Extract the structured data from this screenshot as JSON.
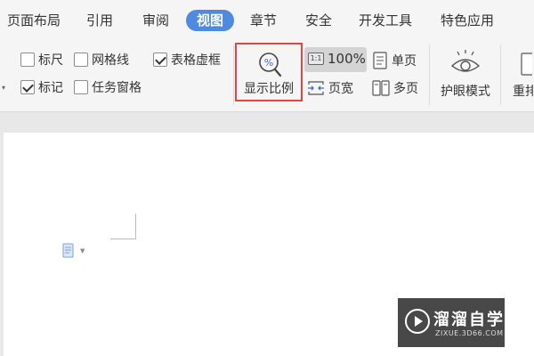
{
  "tabs": [
    {
      "label": "页面布局",
      "active": false
    },
    {
      "label": "引用",
      "active": false
    },
    {
      "label": "审阅",
      "active": false
    },
    {
      "label": "视图",
      "active": true
    },
    {
      "label": "章节",
      "active": false
    },
    {
      "label": "安全",
      "active": false
    },
    {
      "label": "开发工具",
      "active": false
    },
    {
      "label": "特色应用",
      "active": false
    }
  ],
  "ribbon": {
    "checkboxes": [
      {
        "label": "标尺",
        "checked": false
      },
      {
        "label": "网格线",
        "checked": false
      },
      {
        "label": "表格虚框",
        "checked": true
      },
      {
        "label": "标记",
        "checked": true
      },
      {
        "label": "任务窗格",
        "checked": false
      }
    ],
    "zoom_button": {
      "label": "显示比例",
      "icon": "zoom-percent-icon"
    },
    "percent_button": {
      "icon_text": "1:1",
      "label": "100%"
    },
    "single_page": {
      "label": "单页",
      "icon": "single-page-icon"
    },
    "page_width": {
      "label": "页宽",
      "icon": "page-width-icon"
    },
    "multi_page": {
      "label": "多页",
      "icon": "multi-page-icon"
    },
    "eye_care": {
      "label": "护眼模式",
      "icon": "eye-icon"
    },
    "rearrange": {
      "label": "重排",
      "icon": "rearrange-icon"
    }
  },
  "watermark": {
    "brand": "溜溜自学",
    "site": "ZIXUE.3D66.COM"
  },
  "colors": {
    "active_tab": "#4e8ae0",
    "highlight_border": "#e04545"
  }
}
